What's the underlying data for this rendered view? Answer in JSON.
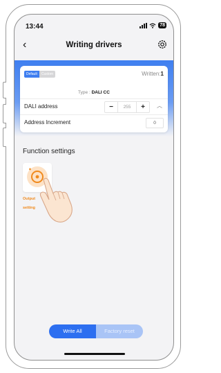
{
  "status_bar": {
    "time": "13:44",
    "battery": "78"
  },
  "header": {
    "title": "Writing drivers"
  },
  "card": {
    "toggle": {
      "default_label": "Default",
      "custom_label": "Custom"
    },
    "written_label": "Written:",
    "written_count": "1",
    "type_label": "Type :",
    "type_value": "DALI CC",
    "dali_address": {
      "label": "DALI address",
      "minus": "−",
      "value": "255",
      "plus": "+"
    },
    "address_increment": {
      "label": "Address Increment",
      "value": "0"
    }
  },
  "function_settings": {
    "title": "Function settings",
    "items": [
      {
        "label_line1": "Output",
        "label_line2": "setting"
      }
    ]
  },
  "bottom_actions": {
    "write_all": "Write All",
    "factory_reset": "Factory reset"
  },
  "colors": {
    "accent": "#2d6ff0",
    "accent_light": "#a9c4f6",
    "orange": "#f08a1d"
  }
}
